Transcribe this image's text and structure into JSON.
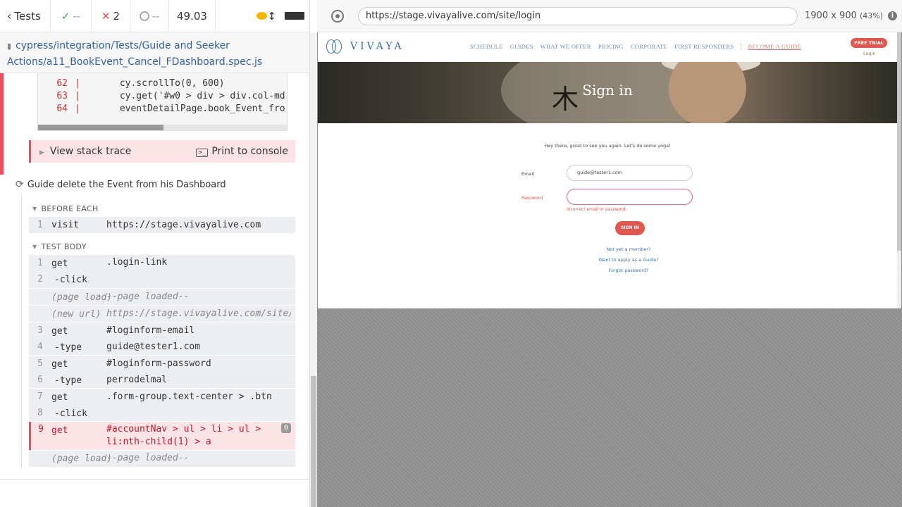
{
  "stats": {
    "tests_label": "Tests",
    "passed": "--",
    "failed": "2",
    "pending": "--",
    "duration": "49.03"
  },
  "spec": {
    "path_line1": "cypress/integration/Tests/Guide and Seeker",
    "path_line2": "Actions/a11_BookEvent_Cancel_FDashboard.spec.js"
  },
  "code_frame": {
    "lines": [
      {
        "num": "62",
        "code": "cy.scrollTo(0, 600)"
      },
      {
        "num": "63",
        "code": "cy.get('#w0 > div > div.col-md"
      },
      {
        "num": "64",
        "code": "eventDetailPage.book_Event_fro"
      }
    ]
  },
  "error_actions": {
    "stack_trace": "View stack trace",
    "print_console": "Print to console"
  },
  "test": {
    "title": "Guide delete the Event from his Dashboard",
    "before_each_label": "BEFORE EACH",
    "test_body_label": "TEST BODY"
  },
  "before_each": [
    {
      "num": "1",
      "name": "visit",
      "msg": "https://stage.vivayalive.com"
    }
  ],
  "commands": [
    {
      "num": "1",
      "name": "get",
      "msg": ".login-link"
    },
    {
      "num": "2",
      "name": "-click",
      "msg": ""
    },
    {
      "num": "",
      "name": "(page load)",
      "msg": "--page loaded--"
    },
    {
      "num": "",
      "name": "(new url)",
      "msg": "https://stage.vivayalive.com/site/l…"
    },
    {
      "num": "3",
      "name": "get",
      "msg": "#loginform-email"
    },
    {
      "num": "4",
      "name": "-type",
      "msg": "guide@tester1.com"
    },
    {
      "num": "5",
      "name": "get",
      "msg": "#loginform-password"
    },
    {
      "num": "6",
      "name": "-type",
      "msg": "perrodelmal"
    },
    {
      "num": "7",
      "name": "get",
      "msg": ".form-group.text-center > .btn"
    },
    {
      "num": "8",
      "name": "-click",
      "msg": ""
    },
    {
      "num": "9",
      "name": "get",
      "msg": "#accountNav > ul > li > ul > li:nth-child(1) > a",
      "badge": "0"
    },
    {
      "num": "",
      "name": "(page load)",
      "msg": "--page loaded--"
    }
  ],
  "aut": {
    "url": "https://stage.vivayalive.com/site/login",
    "viewport": "1900 x 900",
    "scale": "(43%)"
  },
  "site": {
    "brand": "VIVAYA",
    "nav": [
      "SCHEDULE",
      "GUIDES",
      "WHAT WE OFFER",
      "PRICING",
      "CORPORATE",
      "FIRST RESPONDERS"
    ],
    "become_guide": "BECOME A GUIDE",
    "free_trial": "FREE TRIAL",
    "login": "Login",
    "hero_title": "Sign in",
    "greeting": "Hey there, great to see you again. Let's do some yoga!",
    "email_label": "Email",
    "email_value": "guide@tester1.com",
    "password_label": "Password",
    "password_value": "",
    "error_text": "Incorrect email or password.",
    "signin_button": "SIGN IN",
    "links": [
      "Not yet a member?",
      "Want to apply as a Guide?",
      "Forgot password?"
    ]
  },
  "colors": {
    "pass": "#2bb24c",
    "fail": "#e94f5c",
    "brand": "#3c6ea8",
    "accent": "#e0574f"
  }
}
